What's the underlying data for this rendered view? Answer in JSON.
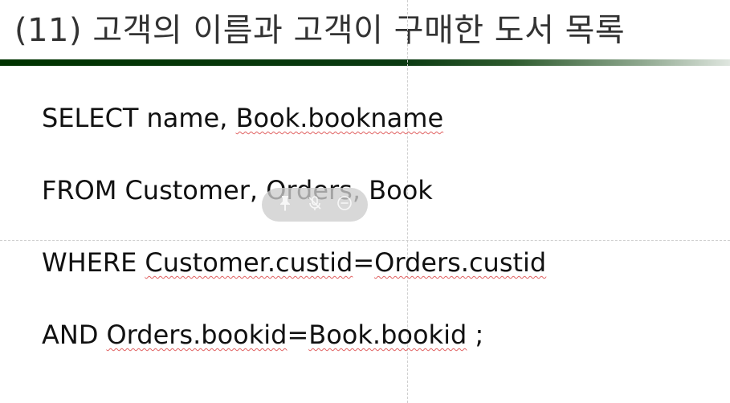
{
  "slide": {
    "title": "(11) 고객의 이름과 고객이 구매한 도서 목록"
  },
  "sql": {
    "line1": {
      "keyword": "SELECT",
      "plain": "name,",
      "spell": "Book.bookname"
    },
    "line2": {
      "keyword": "FROM",
      "plain": "Customer, Orders, Book"
    },
    "line3": {
      "keyword": "WHERE",
      "spell1": "Customer.custid",
      "eq": "=",
      "spell2": "Orders.custid"
    },
    "line4": {
      "keyword": "AND",
      "spell1": "Orders.bookid",
      "eq": "=",
      "spell2": "Book.bookid",
      "tail": ";"
    }
  },
  "toolbar": {
    "icons": [
      "pin-icon",
      "mute-microphone-icon",
      "minus-circle-icon"
    ]
  },
  "colors": {
    "title_bar_start": "#003300",
    "title_bar_end": "#dfe6df",
    "spellcheck": "#e06060",
    "toolbar_bg": "#cdcdcd"
  }
}
